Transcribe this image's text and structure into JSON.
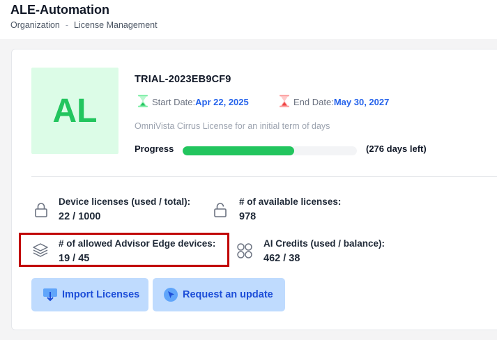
{
  "header": {
    "title": "ALE-Automation",
    "breadcrumb": [
      "Organization",
      "License Management"
    ],
    "breadcrumb_separator": "-"
  },
  "license": {
    "avatar_initials": "AL",
    "id": "TRIAL-2023EB9CF9",
    "start_label": "Start Date:",
    "start_date": "Apr 22, 2025",
    "end_label": "End Date:",
    "end_date": "May 30, 2027",
    "description": "OmniVista Cirrus License for an initial term of days",
    "progress_label": "Progress",
    "progress_percent": 64,
    "days_left": "(276 days left)"
  },
  "stats": {
    "device_label": "Device licenses (used / total):",
    "device_value": "22 / 1000",
    "available_label": "# of available licenses:",
    "available_value": "978",
    "advisor_label": "# of allowed Advisor Edge devices:",
    "advisor_value": "19 / 45",
    "ai_label": "AI Credits (used / balance):",
    "ai_value": "462 / 38"
  },
  "actions": {
    "import_label": "Import Licenses",
    "request_label": "Request an update"
  },
  "colors": {
    "accent": "#2563eb",
    "success": "#22c55e",
    "highlight": "#c00000",
    "button_bg": "#bfdbfe"
  },
  "icons": {
    "start": "hourglass-start-icon",
    "end": "hourglass-end-icon",
    "device": "lock-icon",
    "available": "lock-open-icon",
    "advisor": "layers-icon",
    "ai": "four-circles-icon",
    "import": "import-icon",
    "request": "cursor-icon"
  }
}
